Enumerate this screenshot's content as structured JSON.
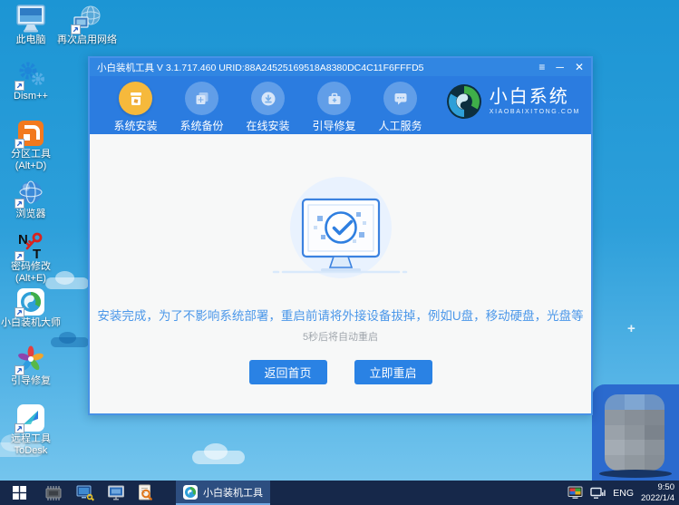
{
  "window": {
    "title": "小白装机工具 V 3.1.717.460 URID:88A24525169518A8380DC4C11F6FFFD5",
    "controls": {
      "menu": "≡",
      "minimize": "─",
      "close": "✕"
    },
    "nav": [
      {
        "label": "系统安装",
        "active": true
      },
      {
        "label": "系统备份",
        "active": false
      },
      {
        "label": "在线安装",
        "active": false
      },
      {
        "label": "引导修复",
        "active": false
      },
      {
        "label": "人工服务",
        "active": false
      }
    ],
    "brand": {
      "name": "小白系统",
      "site": "XIAOBAIXITONG.COM"
    },
    "main": {
      "message": "安装完成，为了不影响系统部署，重启前请将外接设备拔掉，例如U盘，移动硬盘，光盘等",
      "countdown": "5秒后将自动重启",
      "home_button": "返回首页",
      "restart_button": "立即重启"
    }
  },
  "desktop": {
    "icons": [
      {
        "label": "此电脑"
      },
      {
        "label": "再次启用网络"
      },
      {
        "label": "Dism++"
      },
      {
        "label": "分区工具",
        "label2": "(Alt+D)"
      },
      {
        "label": "浏览器"
      },
      {
        "label": "密码修改",
        "label2": "(Alt+E)"
      },
      {
        "label": "小白装机大师"
      },
      {
        "label": "引导修复"
      },
      {
        "label": "远程工具",
        "label2": "ToDesk"
      }
    ]
  },
  "taskbar": {
    "active_task": "小白装机工具",
    "language": "ENG",
    "time": "9:50",
    "date": "2022/1/4"
  },
  "colors": {
    "accent_blue": "#2b7ce0",
    "active_gold": "#f6b93c",
    "message_blue": "#4b97e9",
    "button_blue": "#2a82e4",
    "taskbar_navy": "#16284a",
    "desktop_sky": "#2d9fda"
  }
}
